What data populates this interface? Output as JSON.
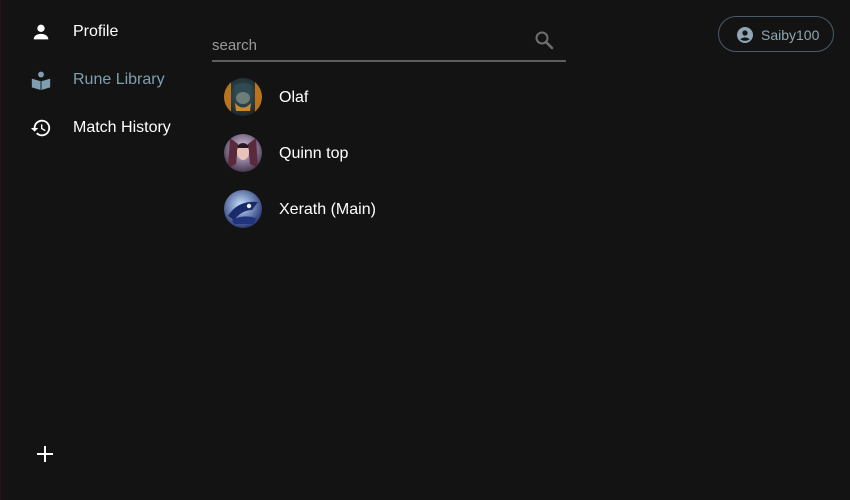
{
  "nav": {
    "items": [
      {
        "label": "Profile",
        "icon": "person-icon",
        "active": false
      },
      {
        "label": "Rune Library",
        "icon": "book-icon",
        "active": true
      },
      {
        "label": "Match History",
        "icon": "history-icon",
        "active": false
      }
    ],
    "add_icon": "plus-icon"
  },
  "search": {
    "value": "",
    "placeholder": "search",
    "icon": "search-icon"
  },
  "rune_pages": [
    {
      "label": "Olaf",
      "avatar": "olaf-avatar"
    },
    {
      "label": "Quinn top",
      "avatar": "quinn-avatar"
    },
    {
      "label": "Xerath (Main)",
      "avatar": "xerath-avatar"
    }
  ],
  "account": {
    "username": "Saiby100",
    "icon": "account-circle-icon"
  },
  "colors": {
    "background": "#131313",
    "text": "#ffffff",
    "active_nav": "#7e9fb0",
    "account_text": "#8fa7b4",
    "search_underline": "#5e5e5e"
  }
}
